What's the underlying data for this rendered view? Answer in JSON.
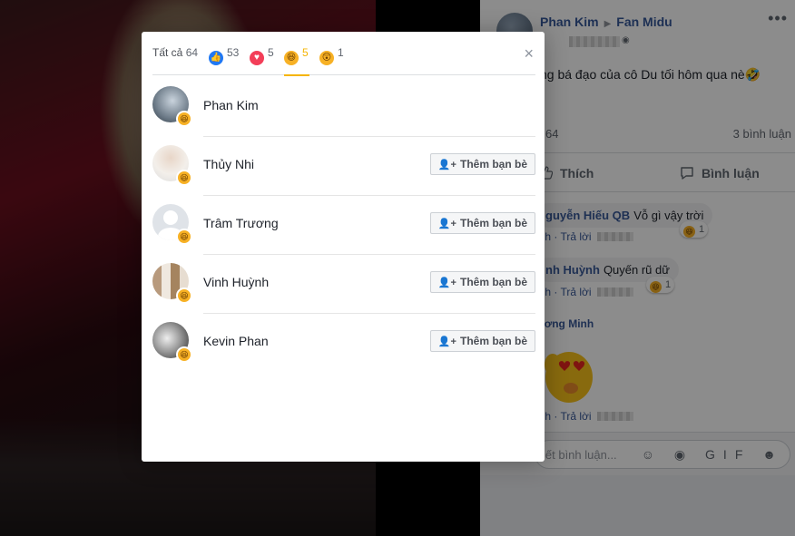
{
  "post": {
    "author": "Phan Kim",
    "page": "Fan Midu",
    "text": "ng bá đạo của cô Du tối hôm qua nè🤣",
    "reaction_count": "64",
    "comments_count": "3 bình luận",
    "like_label": "Thích",
    "comment_label": "Bình luận",
    "more": "•••",
    "comments": [
      {
        "author": "guyễn Hiếu QB",
        "text": "Vỗ gì vậy trời",
        "reactions": "1",
        "actions": "ích · Trả lời"
      },
      {
        "author": "nh Huỳnh",
        "text": "Quyến rũ dữ",
        "reactions": "1",
        "actions": "ích · Trả lời"
      },
      {
        "author": "ương Minh",
        "text": "",
        "actions": "ích · Trả lời"
      }
    ],
    "composer_placeholder": "iết bình luận...",
    "composer_tools": "☺ ◉ GIF ☻"
  },
  "modal": {
    "tabs": [
      {
        "label": "Tất cả",
        "count": "64"
      },
      {
        "icon": "like-icon",
        "count": "53"
      },
      {
        "icon": "love-icon",
        "count": "5"
      },
      {
        "icon": "haha-icon",
        "count": "5"
      },
      {
        "icon": "wow-icon",
        "count": "1"
      }
    ],
    "close": "×",
    "people": [
      {
        "name": "Phan Kim",
        "button": ""
      },
      {
        "name": "Thủy Nhi",
        "button": "Thêm bạn bè"
      },
      {
        "name": "Trâm Trương",
        "button": "Thêm bạn bè"
      },
      {
        "name": "Vinh Huỳnh",
        "button": "Thêm bạn bè"
      },
      {
        "name": "Kevin Phan",
        "button": "Thêm bạn bè"
      }
    ]
  },
  "colors": {
    "link": "#385898",
    "haha": "#f7b125",
    "like": "#2078f4",
    "love": "#f33e58"
  }
}
